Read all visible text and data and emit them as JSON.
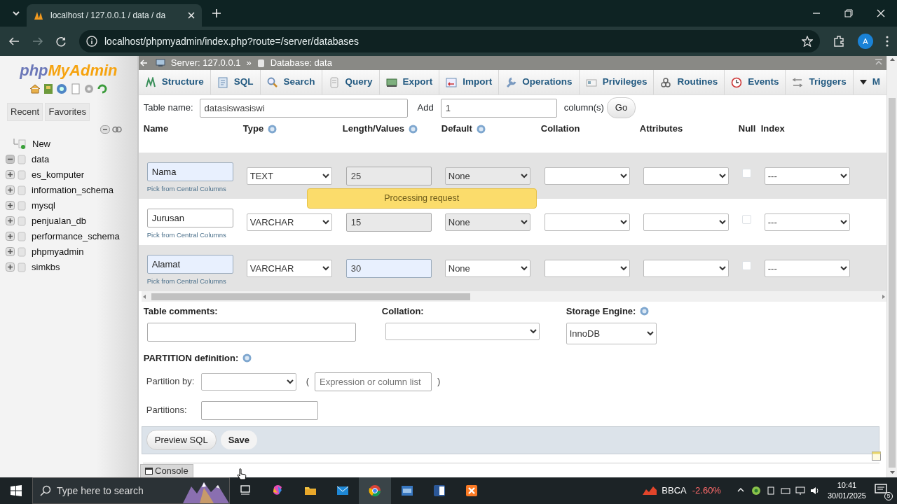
{
  "browser": {
    "tab_title": "localhost / 127.0.0.1 / data / da",
    "url": "localhost/phpmyadmin/index.php?route=/server/databases",
    "profile_initial": "A"
  },
  "sidebar": {
    "logo": [
      "php",
      "MyAdmin"
    ],
    "buttons": [
      "Recent",
      "Favorites"
    ],
    "tree": [
      {
        "label": "New",
        "kind": "new"
      },
      {
        "label": "data",
        "kind": "database",
        "expanded": true
      },
      {
        "label": "es_komputer",
        "kind": "database",
        "expanded": false
      },
      {
        "label": "information_schema",
        "kind": "database",
        "expanded": false
      },
      {
        "label": "mysql",
        "kind": "database",
        "expanded": false
      },
      {
        "label": "penjualan_db",
        "kind": "database",
        "expanded": false
      },
      {
        "label": "performance_schema",
        "kind": "database",
        "expanded": false
      },
      {
        "label": "phpmyadmin",
        "kind": "database",
        "expanded": false
      },
      {
        "label": "simkbs",
        "kind": "database",
        "expanded": false
      }
    ]
  },
  "breadcrumb": {
    "items": [
      "Server: 127.0.0.1",
      "Database: data"
    ],
    "separator": "»"
  },
  "menu": [
    {
      "label": "Structure",
      "kind": "tab"
    },
    {
      "label": "SQL",
      "kind": "tab"
    },
    {
      "label": "Search",
      "kind": "tab"
    },
    {
      "label": "Query",
      "kind": "tab"
    },
    {
      "label": "Export",
      "kind": "tab"
    },
    {
      "label": "Import",
      "kind": "tab"
    },
    {
      "label": "Operations",
      "kind": "tab"
    },
    {
      "label": "Privileges",
      "kind": "tab"
    },
    {
      "label": "Routines",
      "kind": "tab"
    },
    {
      "label": "Events",
      "kind": "tab"
    },
    {
      "label": "Triggers",
      "kind": "tab"
    },
    {
      "label": "M",
      "kind": "more"
    }
  ],
  "form": {
    "table_name_label": "Table name:",
    "table_name": "datasiswasiswi",
    "add_label": "Add",
    "add_count": "1",
    "columns_label": "column(s)",
    "go": "Go"
  },
  "columns": [
    {
      "label": "Name"
    },
    {
      "label": "Type",
      "help": true
    },
    {
      "label": "Length/Values",
      "help": true
    },
    {
      "label": "Default",
      "help": true
    },
    {
      "label": "Collation"
    },
    {
      "label": "Attributes"
    },
    {
      "label": "Null"
    },
    {
      "label": "Index"
    }
  ],
  "rows": [
    {
      "striped": true,
      "name": "Nama",
      "name_highlighted": true,
      "pick_link": "Pick from Central Columns",
      "type": "TEXT",
      "length": "25",
      "length_highlighted": false,
      "shaded": true,
      "default": "None",
      "null_checked": false,
      "index": "---"
    },
    {
      "striped": false,
      "name": "Jurusan",
      "name_highlighted": false,
      "pick_link": "Pick from Central Columns",
      "type": "VARCHAR",
      "length": "15",
      "length_highlighted": false,
      "shaded": true,
      "default": "None",
      "null_checked": false,
      "index": "---"
    },
    {
      "striped": true,
      "name": "Alamat",
      "name_highlighted": true,
      "pick_link": "Pick from Central Columns",
      "type": "VARCHAR",
      "length": "30",
      "length_highlighted": true,
      "shaded": false,
      "default": "None",
      "null_checked": false,
      "index": "---"
    }
  ],
  "notice": "Processing request",
  "table_options": {
    "comments_label": "Table comments:",
    "collation_label": "Collation:",
    "engine_label": "Storage Engine:",
    "engine": "InnoDB"
  },
  "partition": {
    "title": "PARTITION definition:",
    "by_label": "Partition by:",
    "open_paren": "(",
    "expression_placeholder": "Expression or column list",
    "close_paren": ")",
    "partitions_label": "Partitions:"
  },
  "actions": [
    {
      "label": "Preview SQL",
      "kind": "secondary"
    },
    {
      "label": "Save",
      "kind": "primary"
    }
  ],
  "console": "Console",
  "taskbar": {
    "search_placeholder": "Type here to search",
    "ticker": "BBCA",
    "change": "-2.60%",
    "time": "10:41",
    "date": "30/01/2025",
    "notifications": "5"
  }
}
